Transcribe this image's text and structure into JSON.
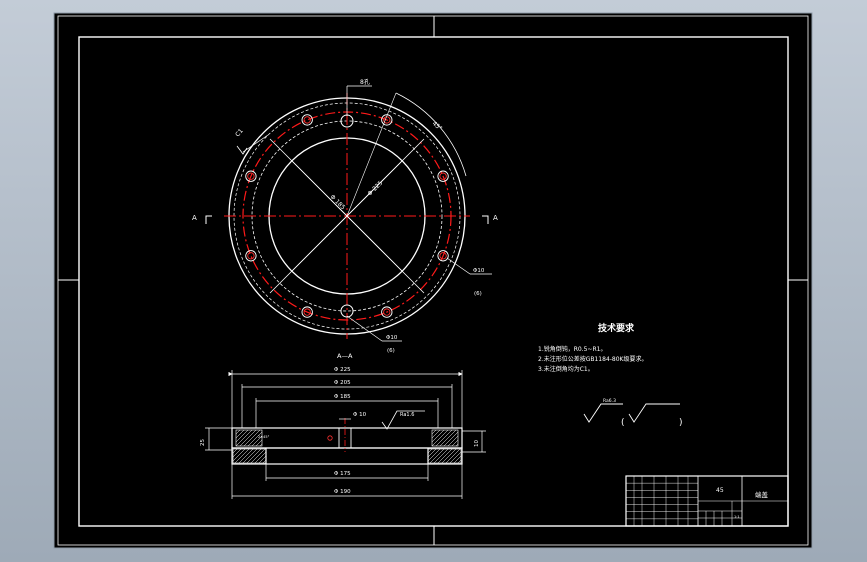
{
  "drawing": {
    "colors": {
      "background": "#000000",
      "line": "#ffffff",
      "center_line": "#ff1a1a",
      "hole_ring": "#ff3030",
      "viewport_frame": "#b9c3ce"
    },
    "plan_view": {
      "hole_count": 8,
      "section_labels": {
        "left": "A",
        "right": "A",
        "bottom": "A—A"
      },
      "dimensions": {
        "hole_callout": "8孔",
        "chamfer_callout": "C1",
        "angle_callout": "45°",
        "dia_inner": "Φ 185",
        "dia_pitch": "Φ 225",
        "hole_right": "Φ10",
        "hole_right_sub": "(6)",
        "hole_bottom": "Φ10",
        "hole_bottom_sub": "(6)"
      }
    },
    "section_view": {
      "dimensions": {
        "top_1": "Φ 225",
        "top_2": "Φ 205",
        "top_3": "Φ 185",
        "hole": "Φ 10",
        "bottom_1": "Φ 175",
        "bottom_2": "Φ 190",
        "height_left": "25",
        "height_right": "10",
        "surface_value": "Ra1.6",
        "small_tag": "2×45°"
      }
    },
    "notes": {
      "title": "技术要求",
      "lines": [
        "1.锐角倒钝，R0.5~R1。",
        "2.未注形位公差按GB1184-80K级要求。",
        "3.未注倒角均为C1。"
      ]
    },
    "surface_finish": {
      "symbol_label": "Ra6.3",
      "paren_open": "(",
      "paren_close": ")"
    },
    "title_block": {
      "material": "45",
      "part_name": "端盖",
      "scale_mark": "1:1"
    }
  }
}
